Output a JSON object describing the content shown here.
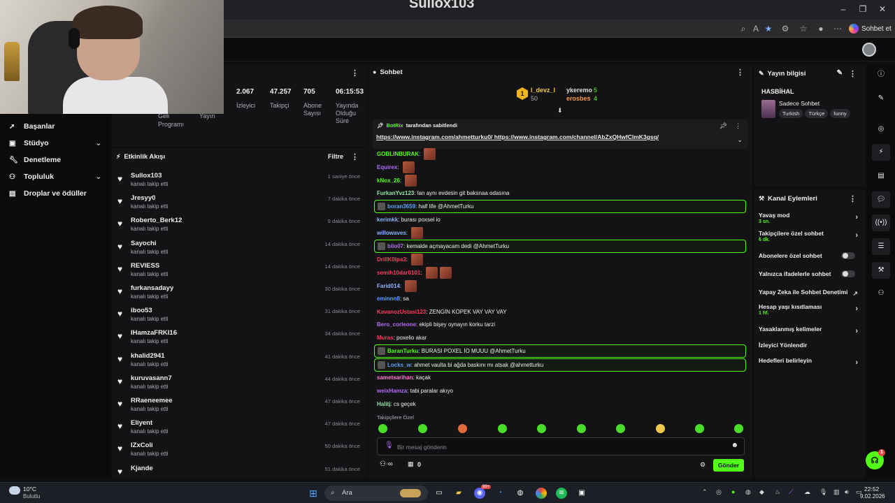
{
  "window": {
    "title": "Sullox103"
  },
  "browser": {
    "copilot_label": "Sohbet et"
  },
  "sidebar": {
    "items": [
      {
        "label": "Başanlar",
        "icon": "rocket-icon",
        "has_chevron": false
      },
      {
        "label": "Stüdyo",
        "icon": "camera-icon",
        "has_chevron": true
      },
      {
        "label": "Denetleme",
        "icon": "wrench-icon",
        "has_chevron": false
      },
      {
        "label": "Topluluk",
        "icon": "people-icon",
        "has_chevron": true
      },
      {
        "label": "Droplar ve ödüller",
        "icon": "gift-icon",
        "has_chevron": false
      }
    ]
  },
  "stats": {
    "partial_labels": [
      "Geli",
      "Programı",
      "Yayın"
    ],
    "items": [
      {
        "value": "2.067",
        "label": "İzleyici"
      },
      {
        "value": "47.257",
        "label": "Takipçi"
      },
      {
        "value": "705",
        "label": "Abone Sayısı"
      },
      {
        "value": "06:15:53",
        "label": "Yayında Olduğu Süre"
      }
    ]
  },
  "activity": {
    "title": "Etkinlik Akışı",
    "filter_label": "Filtre",
    "items": [
      {
        "name": "Sullox103",
        "desc": "kanalı takip etti",
        "time": "1 saniye önce"
      },
      {
        "name": "Jresyy0",
        "desc": "kanalı takip etti",
        "time": "7 dakika önce"
      },
      {
        "name": "Roberto_Berk12",
        "desc": "kanalı takip etti",
        "time": "9 dakika önce"
      },
      {
        "name": "Sayochi",
        "desc": "kanalı takip etti",
        "time": "14 dakika önce"
      },
      {
        "name": "REVIESS",
        "desc": "kanalı takip etti",
        "time": "14 dakika önce"
      },
      {
        "name": "furkansadayy",
        "desc": "kanalı takip etti",
        "time": "30 dakika önce"
      },
      {
        "name": "iboo53",
        "desc": "kanalı takip etti",
        "time": "31 dakika önce"
      },
      {
        "name": "IHamzaFRKI16",
        "desc": "kanalı takip etti",
        "time": "34 dakika önce"
      },
      {
        "name": "khalid2941",
        "desc": "kanalı takip etti",
        "time": "41 dakika önce"
      },
      {
        "name": "kuruvasann7",
        "desc": "kanalı takip etti",
        "time": "44 dakika önce"
      },
      {
        "name": "RRaeneemee",
        "desc": "kanalı takip etti",
        "time": "47 dakika önce"
      },
      {
        "name": "Eliyent",
        "desc": "kanalı takip etti",
        "time": "47 dakika önce"
      },
      {
        "name": "IZxColi",
        "desc": "kanalı takip etti",
        "time": "50 dakika önce"
      },
      {
        "name": "Kjande",
        "desc": "",
        "time": "51 dakika önce"
      }
    ]
  },
  "chat": {
    "title": "Sohbet",
    "leaders": [
      {
        "rank": "1",
        "name": "l_devz_l",
        "count": "50"
      },
      {
        "name": "ykeremo",
        "count": "5"
      },
      {
        "name": "erosbes",
        "count": "4"
      }
    ],
    "pinned": {
      "author": "BotRix",
      "suffix": "tarafından sabitlendi",
      "links": "https://www.instagram.com/ahmetturku0/ https://www.instagram.com/channel/AbZxQHwfClmK3gsq/"
    },
    "messages": [
      {
        "user": "GOBLINBURAK",
        "text": "",
        "color": "#53fc18",
        "emotes": 1,
        "hl": false
      },
      {
        "user": "Equirex",
        "text": "",
        "color": "#b26bf5",
        "emotes": 1,
        "hl": false
      },
      {
        "user": "kNox_26",
        "text": "",
        "color": "#53fc18",
        "emotes": 1,
        "hl": false
      },
      {
        "user": "FurkanYvz123",
        "text": "lan aynı evdesin git baksnaa odasına",
        "color": "#8fe3a4",
        "emotes": 0,
        "hl": false
      },
      {
        "user": "boran3659",
        "text": "half life @AhmetTurku",
        "color": "#5aa0ff",
        "emotes": 0,
        "hl": true
      },
      {
        "user": "kerimkk",
        "text": "burası poxsel io",
        "color": "#8ab4ff",
        "emotes": 0,
        "hl": false
      },
      {
        "user": "willowaves",
        "text": "",
        "color": "#8ab4ff",
        "emotes": 1,
        "hl": false
      },
      {
        "user": "bilo07",
        "text": "kemalde açmayacam dedi @AhmetTurku",
        "color": "#b26bf5",
        "emotes": 0,
        "hl": true
      },
      {
        "user": "DrillK0lpa3",
        "text": "",
        "color": "#ff3b5c",
        "emotes": 1,
        "hl": false
      },
      {
        "user": "semih10dar0101",
        "text": "",
        "color": "#ff3b5c",
        "emotes": 2,
        "hl": false
      },
      {
        "user": "Farid014",
        "text": "",
        "color": "#8ab4ff",
        "emotes": 1,
        "hl": false
      },
      {
        "user": "eminnn8",
        "text": "sa",
        "color": "#5aa0ff",
        "emotes": 0,
        "hl": false
      },
      {
        "user": "KavanozUstasi123",
        "text": "ZENGİN KOPEK VAY VAY VAY",
        "color": "#ff3b5c",
        "emotes": 0,
        "hl": false
      },
      {
        "user": "Bero_corleone",
        "text": "ekipli bişey oynayın korku tarzi",
        "color": "#b26bf5",
        "emotes": 0,
        "hl": false
      },
      {
        "user": "Muras",
        "text": "poxelio akar",
        "color": "#ff3b5c",
        "emotes": 0,
        "hl": false
      },
      {
        "user": "BaranTurku",
        "text": "BURASI POXEL İO MUUU @AhmetTurku",
        "color": "#53fc18",
        "emotes": 0,
        "hl": true
      },
      {
        "user": "Locks_w",
        "text": "ahmet vaulta bi ağda baskını mı atsak @ahmetturku",
        "color": "#5aa0ff",
        "emotes": 0,
        "hl": true
      },
      {
        "user": "sametsarihan",
        "text": "kaçak",
        "color": "#ff7bd0",
        "emotes": 0,
        "hl": false
      },
      {
        "user": "weixHamza",
        "text": "tabi paralar akıyo",
        "color": "#b26bf5",
        "emotes": 0,
        "hl": false
      },
      {
        "user": "Halitj",
        "text": "cs geçek",
        "color": "#8fe3a4",
        "emotes": 0,
        "hl": false
      }
    ],
    "followers_only_label": "Takipçilere Özel",
    "input_placeholder": "Bir mesaj gönderin",
    "points": "0",
    "send_label": "Gönder"
  },
  "stream_info": {
    "title": "Yayın bilgisi",
    "stream_title": "HASBİHAL",
    "category": "Sadece Sohbet",
    "tags": [
      "Turkish",
      "Türkçe",
      "funny"
    ]
  },
  "channel_actions": {
    "title": "Kanal Eylemleri",
    "items": [
      {
        "label": "Yavaş mod",
        "sub": "3 sn.",
        "control": "chevron"
      },
      {
        "label": "Takipçilere özel sohbet",
        "sub": "6 dk.",
        "control": "chevron"
      },
      {
        "label": "Abonelere özel sohbet",
        "sub": "",
        "control": "toggle"
      },
      {
        "label": "Yalnızca ifadelerle sohbet",
        "sub": "",
        "control": "toggle"
      },
      {
        "label": "Yapay Zeka ile Sohbet Denetimi",
        "sub": "",
        "control": "chart"
      },
      {
        "label": "Hesap yaşı kısıtlaması",
        "sub": "1 hf.",
        "control": "chevron"
      },
      {
        "label": "Yasaklanmış kelimeler",
        "sub": "",
        "control": "chevron"
      },
      {
        "label": "İzleyici Yönlendir",
        "sub": "",
        "control": "none"
      },
      {
        "label": "Hedefleri belirleyin",
        "sub": "",
        "control": "chevron"
      }
    ]
  },
  "help_badge": "1",
  "taskbar": {
    "weather_temp": "10°C",
    "weather_desc": "Bulutlu",
    "search_label": "Ara",
    "discord_badge": "99+",
    "time": "22:52",
    "date": "9.02.2026"
  }
}
